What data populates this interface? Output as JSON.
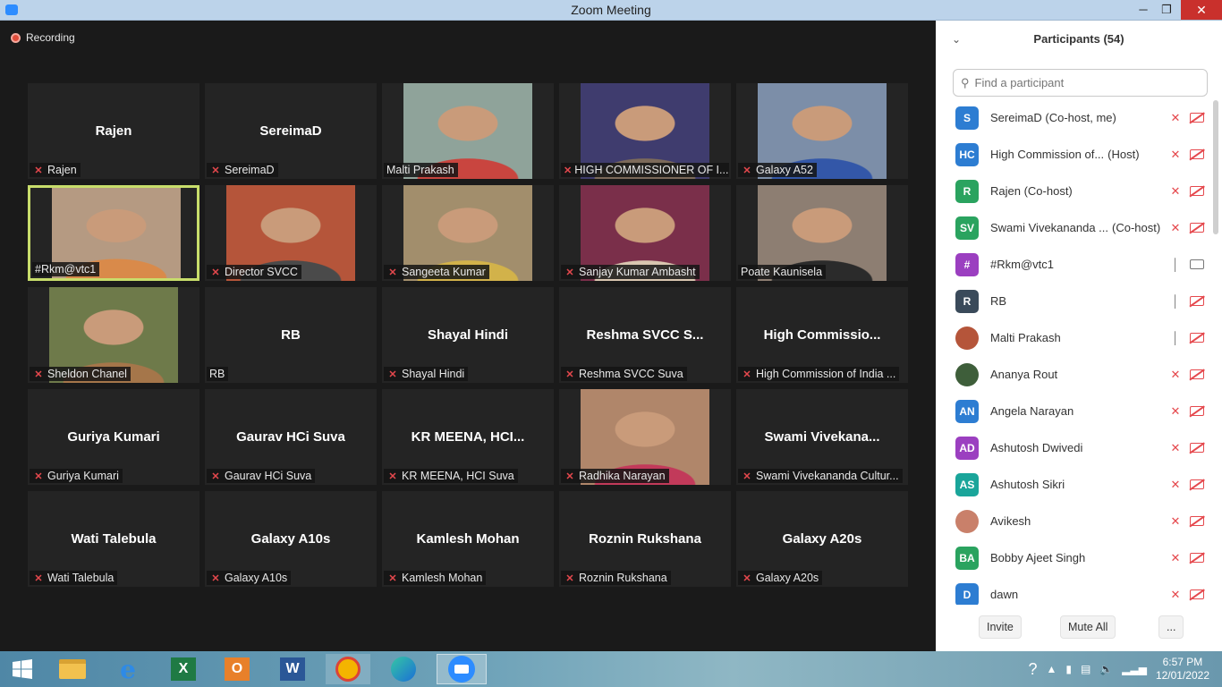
{
  "window": {
    "title": "Zoom Meeting",
    "minimize": "─",
    "maximize": "❐",
    "close": "✕"
  },
  "recording": {
    "label": "Recording"
  },
  "tiles": [
    {
      "name": "Rajen",
      "label": "Rajen",
      "muted": true,
      "video": false
    },
    {
      "name": "SereimaD",
      "label": "SereimaD",
      "muted": true,
      "video": false
    },
    {
      "name": "",
      "label": "Malti Prakash",
      "muted": false,
      "video": true,
      "bg": "#8fa39a",
      "fg": "#c9453f"
    },
    {
      "name": "",
      "label": "HIGH COMMISSIONER OF I...",
      "muted": true,
      "video": true,
      "bg": "#3f3c6e",
      "fg": "#7c6a5a"
    },
    {
      "name": "",
      "label": "Galaxy A52",
      "muted": true,
      "video": true,
      "bg": "#7c8ea8",
      "fg": "#3357a8"
    },
    {
      "name": "",
      "label": "#Rkm@vtc1",
      "muted": false,
      "video": true,
      "active": true,
      "bg": "#b59a82",
      "fg": "#d98a4a"
    },
    {
      "name": "",
      "label": "Director SVCC",
      "muted": true,
      "video": true,
      "bg": "#b5553a",
      "fg": "#4a4a4a"
    },
    {
      "name": "",
      "label": "Sangeeta Kumar",
      "muted": true,
      "video": true,
      "bg": "#a28e6c",
      "fg": "#d2b24a"
    },
    {
      "name": "",
      "label": "Sanjay Kumar Ambasht",
      "muted": true,
      "video": true,
      "bg": "#7a2f4a",
      "fg": "#d9c6b0"
    },
    {
      "name": "",
      "label": "Poate Kaunisela",
      "muted": false,
      "video": true,
      "bg": "#8d7e72",
      "fg": "#2b2b2b"
    },
    {
      "name": "",
      "label": "Sheldon Chanel",
      "muted": true,
      "video": true,
      "bg": "#6e7a4a",
      "fg": "#a5764a"
    },
    {
      "name": "RB",
      "label": "RB",
      "muted": false,
      "video": false
    },
    {
      "name": "Shayal Hindi",
      "label": "Shayal Hindi",
      "muted": true,
      "video": false
    },
    {
      "name": "Reshma SVCC S...",
      "label": "Reshma SVCC Suva",
      "muted": true,
      "video": false
    },
    {
      "name": "High  Commissio...",
      "label": "High Commission of India ...",
      "muted": true,
      "video": false
    },
    {
      "name": "Guriya Kumari",
      "label": "Guriya Kumari",
      "muted": true,
      "video": false
    },
    {
      "name": "Gaurav HCi Suva",
      "label": "Gaurav HCi Suva",
      "muted": true,
      "video": false
    },
    {
      "name": "KR  MEENA,  HCI...",
      "label": "KR MEENA, HCI Suva",
      "muted": true,
      "video": false
    },
    {
      "name": "",
      "label": "Radhika Narayan",
      "muted": true,
      "video": true,
      "bg": "#b0866a",
      "fg": "#c23a5a"
    },
    {
      "name": "Swami  Vivekana...",
      "label": "Swami Vivekananda Cultur...",
      "muted": true,
      "video": false
    },
    {
      "name": "Wati Talebula",
      "label": "Wati Talebula",
      "muted": true,
      "video": false
    },
    {
      "name": "Galaxy A10s",
      "label": "Galaxy A10s",
      "muted": true,
      "video": false
    },
    {
      "name": "Kamlesh Mohan",
      "label": "Kamlesh Mohan",
      "muted": true,
      "video": false
    },
    {
      "name": "Roznin Rukshana",
      "label": "Roznin Rukshana",
      "muted": true,
      "video": false
    },
    {
      "name": "Galaxy A20s",
      "label": "Galaxy A20s",
      "muted": true,
      "video": false
    }
  ],
  "panel": {
    "title": "Participants (54)",
    "collapse_icon": "⌄",
    "search_placeholder": "Find a participant",
    "participants": [
      {
        "initials": "S",
        "color": "#2d7dd2",
        "name": "SereimaD (Co-host, me)",
        "role": "",
        "mic": "muted",
        "cam": "off"
      },
      {
        "initials": "HC",
        "color": "#2d7dd2",
        "name": "High Commission of...",
        "role": "(Host)",
        "mic": "muted",
        "cam": "off"
      },
      {
        "initials": "R",
        "color": "#2aa35f",
        "name": "Rajen (Co-host)",
        "role": "",
        "mic": "muted",
        "cam": "off"
      },
      {
        "initials": "SV",
        "color": "#2aa35f",
        "name": "Swami Vivekananda ...",
        "role": "(Co-host)",
        "mic": "muted",
        "cam": "off"
      },
      {
        "initials": "#",
        "color": "#9b3fc0",
        "name": "#Rkm@vtc1",
        "role": "",
        "mic": "on",
        "cam": "on"
      },
      {
        "initials": "R",
        "color": "#3a4a5a",
        "name": "RB",
        "role": "",
        "mic": "on",
        "cam": "off"
      },
      {
        "initials": "",
        "color": "#b5553a",
        "name": "Malti Prakash",
        "role": "",
        "mic": "on",
        "cam": "off"
      },
      {
        "initials": "",
        "color": "#3e5e3a",
        "name": "Ananya Rout",
        "role": "",
        "mic": "muted",
        "cam": "off"
      },
      {
        "initials": "AN",
        "color": "#2d7dd2",
        "name": "Angela Narayan",
        "role": "",
        "mic": "muted",
        "cam": "off"
      },
      {
        "initials": "AD",
        "color": "#9b3fc0",
        "name": "Ashutosh Dwivedi",
        "role": "",
        "mic": "muted",
        "cam": "off"
      },
      {
        "initials": "AS",
        "color": "#1aa59a",
        "name": "Ashutosh Sikri",
        "role": "",
        "mic": "muted",
        "cam": "off"
      },
      {
        "initials": "",
        "color": "#c9806a",
        "name": "Avikesh",
        "role": "",
        "mic": "muted",
        "cam": "off"
      },
      {
        "initials": "BA",
        "color": "#2aa35f",
        "name": "Bobby Ajeet Singh",
        "role": "",
        "mic": "muted",
        "cam": "off"
      },
      {
        "initials": "D",
        "color": "#2d7dd2",
        "name": "dawn",
        "role": "",
        "mic": "muted",
        "cam": "off"
      }
    ],
    "invite": "Invite",
    "mute_all": "Mute All",
    "more": "..."
  },
  "taskbar": {
    "start_icon": "windows-logo",
    "apps": [
      "file-explorer",
      "internet-explorer",
      "excel",
      "outlook",
      "word",
      "chrome-like",
      "edge",
      "zoom"
    ],
    "active_app": "zoom",
    "time": "6:57 PM",
    "date": "12/01/2022"
  }
}
